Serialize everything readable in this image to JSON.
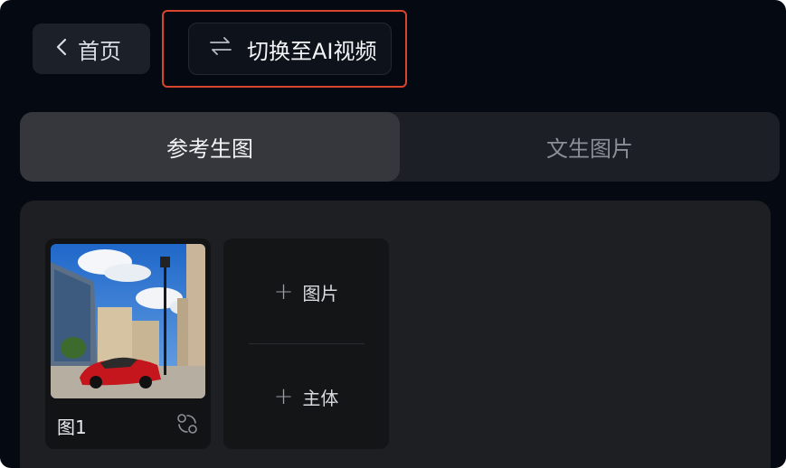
{
  "header": {
    "back_label": "首页",
    "switch_label": "切换至AI视频"
  },
  "tabs": [
    {
      "label": "参考生图",
      "active": true
    },
    {
      "label": "文生图片",
      "active": false
    }
  ],
  "images": [
    {
      "label": "图1"
    }
  ],
  "add_buttons": {
    "image_label": "图片",
    "subject_label": "主体"
  },
  "colors": {
    "background": "#050a12",
    "highlight_border": "#d9442c",
    "active_tab": "#35373d"
  }
}
